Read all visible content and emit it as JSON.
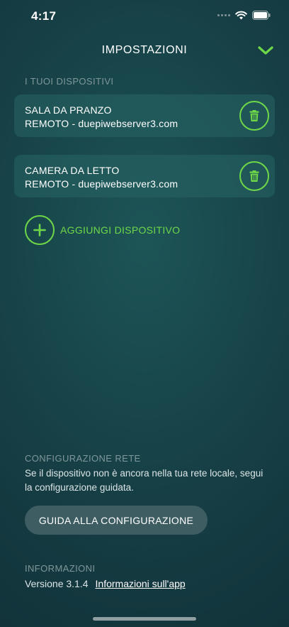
{
  "status_bar": {
    "time": "4:17"
  },
  "header": {
    "title": "IMPOSTAZIONI"
  },
  "devices_section": {
    "label": "I TUOI DISPOSITIVI",
    "devices": [
      {
        "name": "SALA DA PRANZO",
        "server": "REMOTO - duepiwebserver3.com"
      },
      {
        "name": "CAMERA DA LETTO",
        "server": "REMOTO - duepiwebserver3.com"
      }
    ],
    "add_label": "AGGIUNGI DISPOSITIVO"
  },
  "network_section": {
    "label": "CONFIGURAZIONE RETE",
    "description": "Se il dispositivo non è ancora nella tua rete locale, segui la configurazione guidata.",
    "button_label": "GUIDA ALLA CONFIGURAZIONE"
  },
  "info_section": {
    "label": "INFORMAZIONI",
    "version": "Versione 3.1.4",
    "about_link": "Informazioni sull'app"
  },
  "colors": {
    "accent": "#6ed848",
    "background_center": "#1d5557",
    "background_edge": "#0f2b33",
    "card": "#23585a",
    "button": "#3d5d62",
    "muted_label": "#7f979a"
  },
  "icons": [
    "signal-icon",
    "wifi-icon",
    "battery-icon",
    "chevron-down-icon",
    "trash-icon",
    "plus-icon"
  ]
}
